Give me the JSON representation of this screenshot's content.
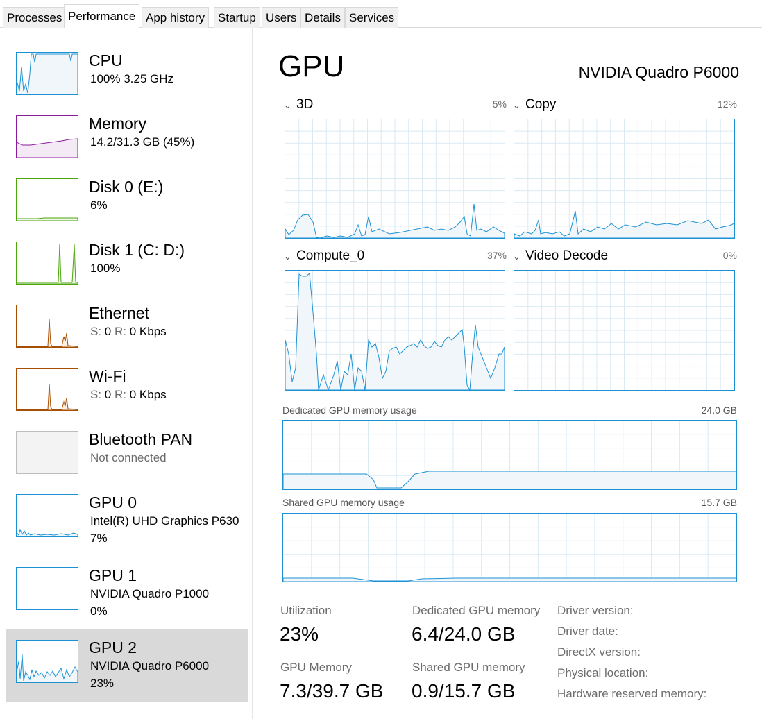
{
  "tabs": [
    "Processes",
    "Performance",
    "App history",
    "Startup",
    "Users",
    "Details",
    "Services"
  ],
  "sidebar": {
    "devices": [
      {
        "title": "CPU",
        "line1": "100%  3.25 GHz",
        "color": "#1b91d4"
      },
      {
        "title": "Memory",
        "line1": "14.2/31.3 GB (45%)",
        "color": "#8b1b9c"
      },
      {
        "title": "Disk 0 (E:)",
        "line1": "6%",
        "color": "#4da60c"
      },
      {
        "title": "Disk 1 (C: D:)",
        "line1": "100%",
        "color": "#4da60c"
      },
      {
        "title": "Ethernet",
        "send_label": "S:",
        "send_value": "0",
        "recv_label": "R:",
        "recv_value": "0 Kbps",
        "color": "#a74f01"
      },
      {
        "title": "Wi-Fi",
        "send_label": "S:",
        "send_value": "0",
        "recv_label": "R:",
        "recv_value": "0 Kbps",
        "color": "#a74f01"
      },
      {
        "title": "Bluetooth PAN",
        "line1": "Not connected",
        "color": "#bdbdbd"
      },
      {
        "title": "GPU 0",
        "line1": "Intel(R) UHD Graphics P630",
        "line2": "7%",
        "color": "#1b91d4"
      },
      {
        "title": "GPU 1",
        "line1": "NVIDIA Quadro P1000",
        "line2": "0%",
        "color": "#1b91d4"
      },
      {
        "title": "GPU 2",
        "line1": "NVIDIA Quadro P6000",
        "line2": "23%",
        "color": "#1b91d4",
        "selected": true
      }
    ]
  },
  "main": {
    "title": "GPU",
    "device_name": "NVIDIA Quadro P6000",
    "engines": [
      {
        "name": "3D",
        "percent": "5%"
      },
      {
        "name": "Copy",
        "percent": "12%"
      },
      {
        "name": "Compute_0",
        "percent": "37%"
      },
      {
        "name": "Video Decode",
        "percent": "0%"
      }
    ],
    "dedicated_graph": {
      "label": "Dedicated GPU memory usage",
      "max": "24.0 GB"
    },
    "shared_graph": {
      "label": "Shared GPU memory usage",
      "max": "15.7 GB"
    },
    "stats": {
      "utilization_label": "Utilization",
      "utilization_value": "23%",
      "dedicated_label": "Dedicated GPU memory",
      "dedicated_value": "6.4/24.0 GB",
      "gpu_memory_label": "GPU Memory",
      "gpu_memory_value": "7.3/39.7 GB",
      "shared_label": "Shared GPU memory",
      "shared_value": "0.9/15.7 GB"
    },
    "info_labels": [
      "Driver version:",
      "Driver date:",
      "DirectX version:",
      "Physical location:",
      "Hardware reserved memory:"
    ]
  },
  "colors": {
    "gpu_line": "#1b91d4",
    "gpu_fill": "#f1f6fa",
    "grid": "#d9eaf5",
    "selected_bg": "#d9d9d9"
  }
}
